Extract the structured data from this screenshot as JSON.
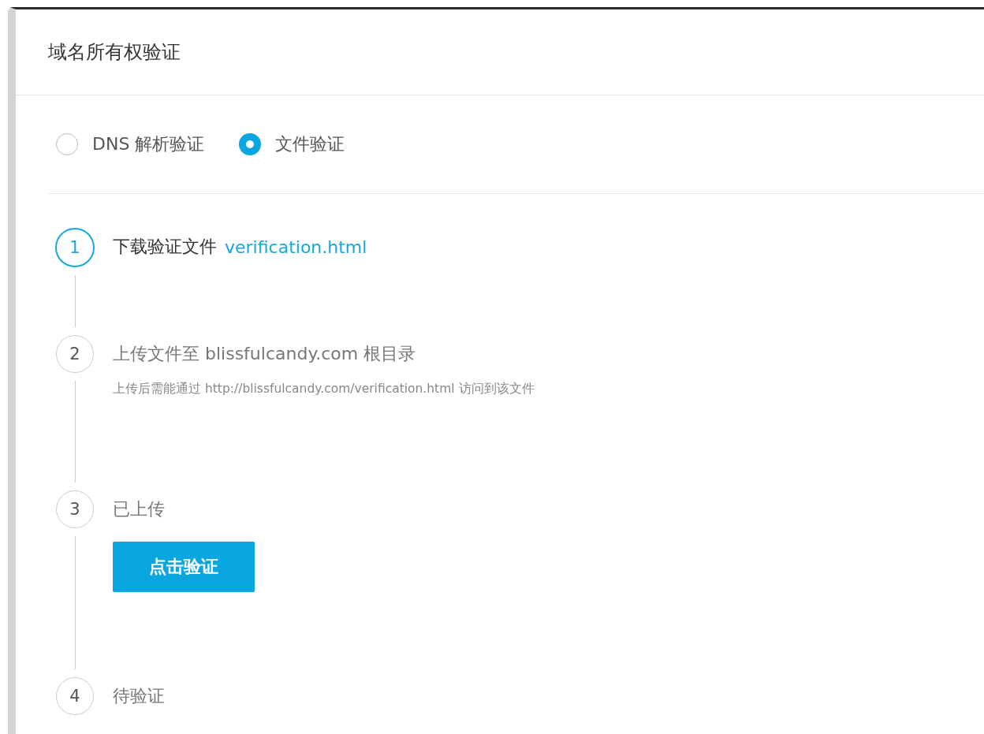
{
  "dialog": {
    "title": "域名所有权验证"
  },
  "methods": [
    {
      "label": "DNS 解析验证",
      "selected": false
    },
    {
      "label": "文件验证",
      "selected": true
    }
  ],
  "steps": [
    {
      "number": "1",
      "active": true,
      "title": "下载验证文件",
      "link": "verification.html"
    },
    {
      "number": "2",
      "active": false,
      "title": "上传文件至 blissfulcandy.com 根目录",
      "note": "上传后需能通过 http://blissfulcandy.com/verification.html 访问到该文件"
    },
    {
      "number": "3",
      "active": false,
      "title": "已上传",
      "button": "点击验证"
    },
    {
      "number": "4",
      "active": false,
      "title": "待验证"
    }
  ]
}
